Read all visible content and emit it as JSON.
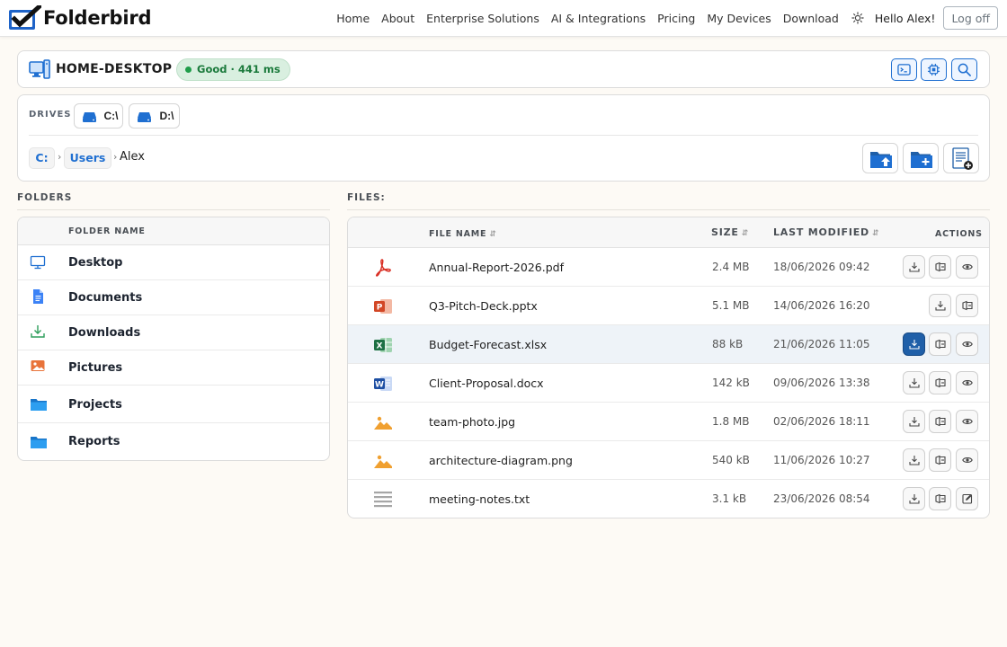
{
  "app": {
    "brand": "Folderbird",
    "nav": [
      "Home",
      "About",
      "Enterprise Solutions",
      "AI & Integrations",
      "Pricing",
      "My Devices",
      "Download"
    ],
    "greeting": "Hello Alex!",
    "logoff_label": "Log off"
  },
  "device": {
    "name": "HOME-DESKTOP",
    "status": "Good · 441 ms",
    "status_color": "#1f9d4a",
    "tools": [
      "terminal-icon",
      "cpu-icon",
      "search-icon"
    ]
  },
  "drives": {
    "label": "DRIVES",
    "items": [
      "C:\\",
      "D:\\"
    ]
  },
  "breadcrumb": {
    "segments": [
      "C:",
      "Users"
    ],
    "current": "Alex"
  },
  "folder_actions": [
    "upload-folder-icon",
    "new-folder-icon",
    "new-file-icon"
  ],
  "folders": {
    "title": "FOLDERS",
    "column": "FOLDER NAME",
    "items": [
      {
        "name": "Desktop",
        "icon": "monitor-icon"
      },
      {
        "name": "Documents",
        "icon": "document-icon"
      },
      {
        "name": "Downloads",
        "icon": "download-icon"
      },
      {
        "name": "Pictures",
        "icon": "picture-icon"
      },
      {
        "name": "Projects",
        "icon": "folder-icon"
      },
      {
        "name": "Reports",
        "icon": "folder-icon"
      }
    ]
  },
  "files": {
    "title": "FILES:",
    "columns": {
      "name": "FILE NAME",
      "size": "SIZE",
      "modified": "LAST MODIFIED",
      "actions": "ACTIONS"
    },
    "rows": [
      {
        "name": "Annual-Report-2026.pdf",
        "size": "2.4 MB",
        "modified": "18/06/2026 09:42",
        "type": "pdf",
        "actions": [
          "download",
          "share",
          "preview"
        ]
      },
      {
        "name": "Q3-Pitch-Deck.pptx",
        "size": "5.1 MB",
        "modified": "14/06/2026 16:20",
        "type": "pptx",
        "actions": [
          "download",
          "share"
        ]
      },
      {
        "name": "Budget-Forecast.xlsx",
        "size": "88 kB",
        "modified": "21/06/2026 11:05",
        "type": "xlsx",
        "actions": [
          "download",
          "share",
          "preview"
        ],
        "highlighted": true
      },
      {
        "name": "Client-Proposal.docx",
        "size": "142 kB",
        "modified": "09/06/2026 13:38",
        "type": "docx",
        "actions": [
          "download",
          "share",
          "preview"
        ]
      },
      {
        "name": "team-photo.jpg",
        "size": "1.8 MB",
        "modified": "02/06/2026 18:11",
        "type": "image",
        "actions": [
          "download",
          "share",
          "preview"
        ]
      },
      {
        "name": "architecture-diagram.png",
        "size": "540 kB",
        "modified": "11/06/2026 10:27",
        "type": "image",
        "actions": [
          "download",
          "share",
          "preview"
        ]
      },
      {
        "name": "meeting-notes.txt",
        "size": "3.1 kB",
        "modified": "23/06/2026 08:54",
        "type": "text",
        "actions": [
          "download",
          "share",
          "edit"
        ]
      }
    ]
  },
  "colors": {
    "accent": "#1f6fd1",
    "page_background": "#fdfaf5",
    "row_highlight": "#eef3f8",
    "primary_action": "#1f5fa8"
  }
}
